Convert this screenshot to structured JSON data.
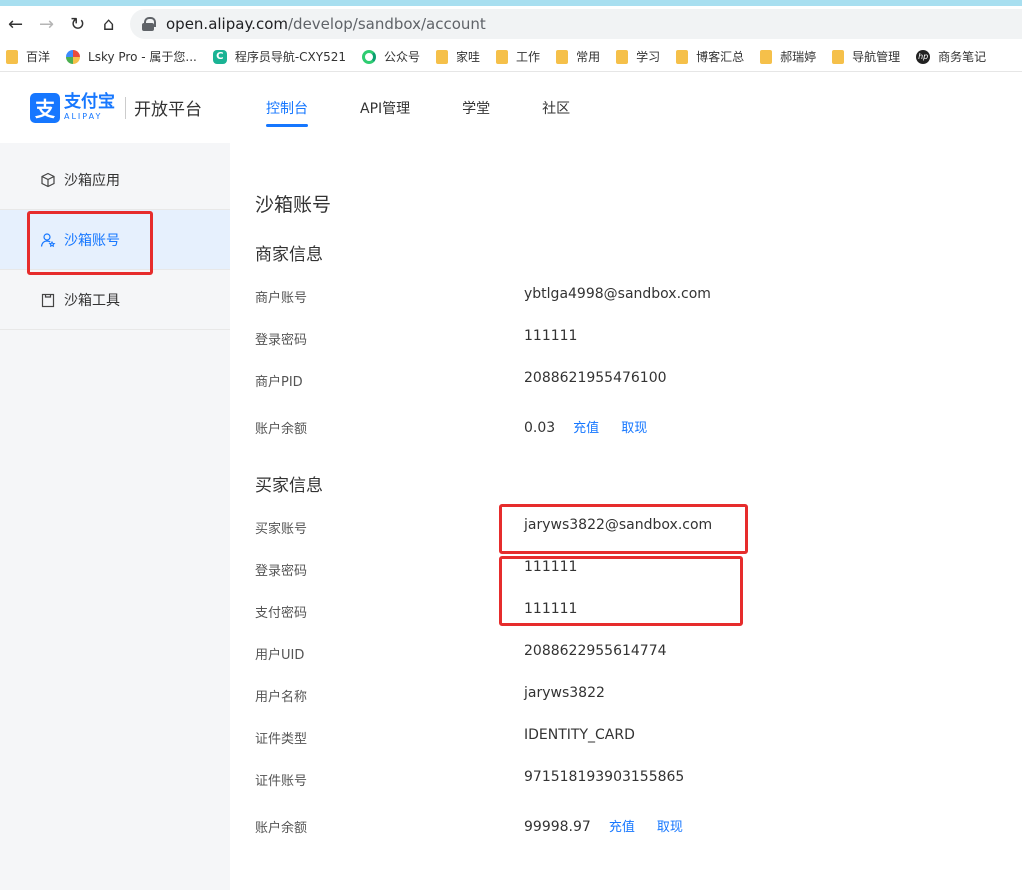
{
  "browser": {
    "url_host": "open.alipay.com",
    "url_path": "/develop/sandbox/account",
    "bookmarks": [
      "百洋",
      "Lsky Pro - 属于您...",
      "程序员导航-CXY521",
      "公众号",
      "家哇",
      "工作",
      "常用",
      "学习",
      "博客汇总",
      "郝瑞婷",
      "导航管理",
      "商务笔记"
    ],
    "hp_label": "hp",
    "c_badge": "C"
  },
  "header": {
    "logo_mark": "支",
    "logo_cn": "支付宝",
    "logo_en": "ALIPAY",
    "platform": "开放平台",
    "nav": [
      {
        "label": "控制台"
      },
      {
        "label": "API管理"
      },
      {
        "label": "学堂"
      },
      {
        "label": "社区"
      }
    ]
  },
  "sidebar": {
    "items": [
      {
        "label": "沙箱应用"
      },
      {
        "label": "沙箱账号"
      },
      {
        "label": "沙箱工具"
      }
    ]
  },
  "content": {
    "page_title": "沙箱账号",
    "merchant": {
      "title": "商家信息",
      "account_label": "商户账号",
      "account": "ybtlga4998@sandbox.com",
      "password_label": "登录密码",
      "password": "111111",
      "pid_label": "商户PID",
      "pid": "2088621955476100",
      "balance_label": "账户余额",
      "balance": "0.03",
      "recharge": "充值",
      "withdraw": "取现"
    },
    "buyer": {
      "title": "买家信息",
      "account_label": "买家账号",
      "account": "jaryws3822@sandbox.com",
      "password_label": "登录密码",
      "password": "111111",
      "pay_password_label": "支付密码",
      "pay_password": "111111",
      "uid_label": "用户UID",
      "uid": "2088622955614774",
      "name_label": "用户名称",
      "name": "jaryws3822",
      "id_type_label": "证件类型",
      "id_type": "IDENTITY_CARD",
      "id_no_label": "证件账号",
      "id_no": "971518193903155865",
      "balance_label": "账户余额",
      "balance": "99998.97",
      "recharge": "充值",
      "withdraw": "取现"
    }
  },
  "colors": {
    "accent": "#1677ff",
    "highlight_box": "#e62c2c"
  }
}
